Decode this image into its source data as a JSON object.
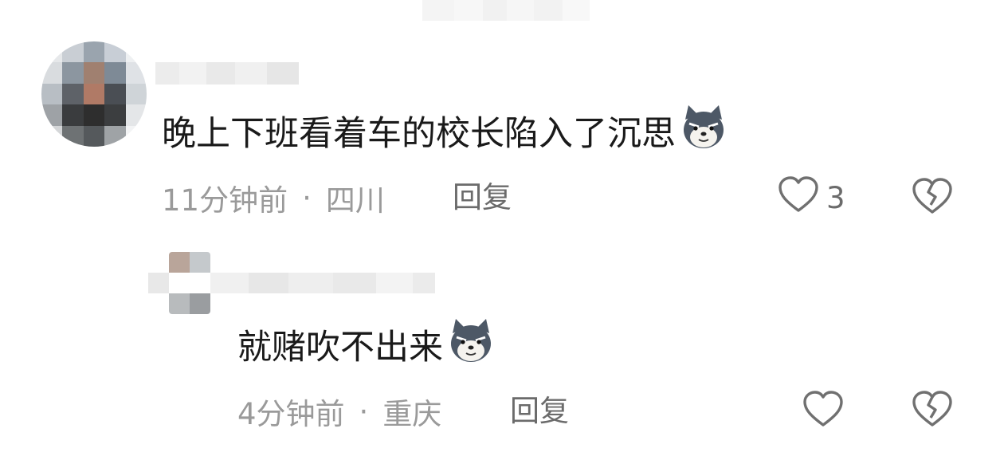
{
  "comments": [
    {
      "text": "晚上下班看着车的校长陷入了沉思",
      "emoji": "dog-emoji",
      "time": "11分钟前",
      "separator": "·",
      "location": "四川",
      "reply_label": "回复",
      "like_count": "3"
    },
    {
      "text": "就赌吹不出来",
      "emoji": "dog-emoji",
      "time": "4分钟前",
      "separator": "·",
      "location": "重庆",
      "reply_label": "回复",
      "like_count": ""
    }
  ],
  "colors": {
    "text": "#1a1a1a",
    "meta": "#9a9a9a",
    "reply": "#6b6b6b",
    "icon": "#707070"
  }
}
